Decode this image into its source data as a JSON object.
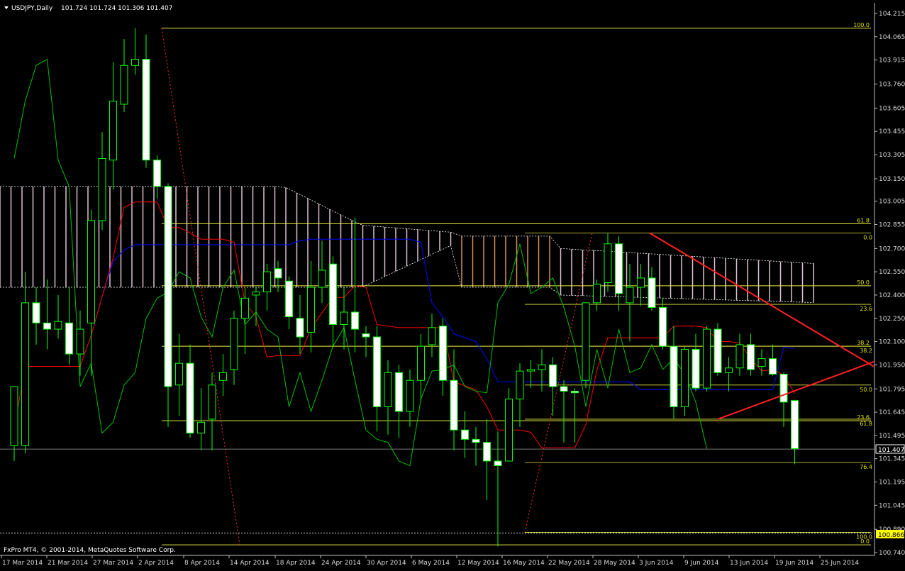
{
  "header": {
    "symbol": "USDJPY,Daily",
    "ohlc": "101.724 101.724 101.306 101.407"
  },
  "footer": "FxPro MT4, © 2001-2014, MetaQuotes Software Corp.",
  "current_price_label": "101.407",
  "marker_price_label": "100.866",
  "colors": {
    "background": "#000000",
    "bull_body": "#000000",
    "bear_body": "#ffffff",
    "candle_outline": "#00ff00",
    "tenkan": "#ff0000",
    "kijun": "#0000ff",
    "chikou": "#00c000",
    "cloud_up": "#f4d6ea",
    "cloud_down": "#f0a060",
    "fib": "#e8e840",
    "trendline": "#ff2020"
  },
  "chart_data": {
    "type": "candlestick",
    "instrument": "USDJPY",
    "timeframe": "Daily",
    "y_ticks": [
      "104.215",
      "104.065",
      "103.915",
      "103.760",
      "103.605",
      "103.455",
      "103.305",
      "103.150",
      "103.005",
      "102.855",
      "102.700",
      "102.550",
      "102.400",
      "102.250",
      "102.100",
      "101.950",
      "101.795",
      "101.645",
      "101.495",
      "101.345",
      "101.195",
      "101.045",
      "100.890",
      "100.740"
    ],
    "x_ticks": [
      "17 Mar 2014",
      "21 Mar 2014",
      "27 Mar 2014",
      "2 Apr 2014",
      "8 Apr 2014",
      "14 Apr 2014",
      "18 Apr 2014",
      "24 Apr 2014",
      "30 Apr 2014",
      "6 May 2014",
      "12 May 2014",
      "16 May 2014",
      "22 May 2014",
      "28 May 2014",
      "3 Jun 2014",
      "9 Jun 2014",
      "13 Jun 2014",
      "19 Jun 2014",
      "25 Jun 2014"
    ],
    "ylim": [
      100.74,
      104.215
    ],
    "candles": [
      {
        "o": 101.43,
        "h": 101.75,
        "l": 101.33,
        "c": 101.81
      },
      {
        "o": 101.43,
        "h": 102.55,
        "l": 101.38,
        "c": 102.35
      },
      {
        "o": 102.35,
        "h": 102.45,
        "l": 102.08,
        "c": 102.22
      },
      {
        "o": 102.22,
        "h": 102.5,
        "l": 102.05,
        "c": 102.18
      },
      {
        "o": 102.18,
        "h": 102.4,
        "l": 102.12,
        "c": 102.23
      },
      {
        "o": 102.22,
        "h": 102.45,
        "l": 101.95,
        "c": 102.02
      },
      {
        "o": 102.02,
        "h": 102.3,
        "l": 101.88,
        "c": 102.18
      },
      {
        "o": 102.22,
        "h": 102.95,
        "l": 101.88,
        "c": 102.88
      },
      {
        "o": 102.88,
        "h": 103.45,
        "l": 102.82,
        "c": 103.28
      },
      {
        "o": 103.27,
        "h": 103.9,
        "l": 103.08,
        "c": 103.65
      },
      {
        "o": 103.63,
        "h": 104.05,
        "l": 103.58,
        "c": 103.88
      },
      {
        "o": 103.88,
        "h": 104.12,
        "l": 103.82,
        "c": 103.92
      },
      {
        "o": 103.92,
        "h": 104.08,
        "l": 103.22,
        "c": 103.27
      },
      {
        "o": 103.27,
        "h": 103.3,
        "l": 103.02,
        "c": 103.1
      },
      {
        "o": 103.1,
        "h": 103.12,
        "l": 101.55,
        "c": 101.81
      },
      {
        "o": 101.82,
        "h": 102.15,
        "l": 101.62,
        "c": 101.96
      },
      {
        "o": 101.96,
        "h": 102.08,
        "l": 101.48,
        "c": 101.51
      },
      {
        "o": 101.51,
        "h": 101.8,
        "l": 101.4,
        "c": 101.58
      },
      {
        "o": 101.6,
        "h": 101.9,
        "l": 101.4,
        "c": 101.82
      },
      {
        "o": 101.85,
        "h": 102.02,
        "l": 101.75,
        "c": 101.9
      },
      {
        "o": 101.92,
        "h": 102.3,
        "l": 101.82,
        "c": 102.25
      },
      {
        "o": 102.25,
        "h": 102.45,
        "l": 102.02,
        "c": 102.38
      },
      {
        "o": 102.4,
        "h": 102.45,
        "l": 102.2,
        "c": 102.42
      },
      {
        "o": 102.42,
        "h": 102.6,
        "l": 102.3,
        "c": 102.55
      },
      {
        "o": 102.57,
        "h": 102.62,
        "l": 102.42,
        "c": 102.51
      },
      {
        "o": 102.49,
        "h": 102.52,
        "l": 102.18,
        "c": 102.26
      },
      {
        "o": 102.25,
        "h": 102.4,
        "l": 102.02,
        "c": 102.13
      },
      {
        "o": 102.16,
        "h": 102.62,
        "l": 102.03,
        "c": 102.45
      },
      {
        "o": 102.45,
        "h": 102.75,
        "l": 102.35,
        "c": 102.56
      },
      {
        "o": 102.6,
        "h": 102.65,
        "l": 102.06,
        "c": 102.21
      },
      {
        "o": 102.21,
        "h": 102.45,
        "l": 102.05,
        "c": 102.29
      },
      {
        "o": 102.29,
        "h": 102.9,
        "l": 102.03,
        "c": 102.18
      },
      {
        "o": 102.15,
        "h": 102.2,
        "l": 102.0,
        "c": 102.13
      },
      {
        "o": 102.13,
        "h": 102.2,
        "l": 101.52,
        "c": 101.68
      },
      {
        "o": 101.68,
        "h": 101.98,
        "l": 101.5,
        "c": 101.9
      },
      {
        "o": 101.9,
        "h": 101.95,
        "l": 101.48,
        "c": 101.65
      },
      {
        "o": 101.65,
        "h": 101.92,
        "l": 101.55,
        "c": 101.85
      },
      {
        "o": 101.85,
        "h": 102.15,
        "l": 101.72,
        "c": 102.07
      },
      {
        "o": 102.08,
        "h": 102.28,
        "l": 102.0,
        "c": 102.19
      },
      {
        "o": 102.2,
        "h": 102.25,
        "l": 101.75,
        "c": 101.85
      },
      {
        "o": 101.85,
        "h": 102.05,
        "l": 101.4,
        "c": 101.53
      },
      {
        "o": 101.53,
        "h": 101.65,
        "l": 101.35,
        "c": 101.47
      },
      {
        "o": 101.47,
        "h": 101.55,
        "l": 101.3,
        "c": 101.45
      },
      {
        "o": 101.45,
        "h": 101.6,
        "l": 101.08,
        "c": 101.33
      },
      {
        "o": 101.33,
        "h": 101.52,
        "l": 100.78,
        "c": 101.3
      },
      {
        "o": 101.33,
        "h": 101.8,
        "l": 101.33,
        "c": 101.73
      },
      {
        "o": 101.73,
        "h": 101.96,
        "l": 101.55,
        "c": 101.91
      },
      {
        "o": 101.91,
        "h": 101.98,
        "l": 101.8,
        "c": 101.92
      },
      {
        "o": 101.92,
        "h": 102.05,
        "l": 101.78,
        "c": 101.95
      },
      {
        "o": 101.95,
        "h": 102.0,
        "l": 101.62,
        "c": 101.81
      },
      {
        "o": 101.81,
        "h": 101.85,
        "l": 101.45,
        "c": 101.78
      },
      {
        "o": 101.78,
        "h": 101.8,
        "l": 101.45,
        "c": 101.77
      },
      {
        "o": 101.85,
        "h": 102.35,
        "l": 101.8,
        "c": 102.35
      },
      {
        "o": 102.35,
        "h": 102.5,
        "l": 102.3,
        "c": 102.47
      },
      {
        "o": 102.48,
        "h": 102.8,
        "l": 102.42,
        "c": 102.73
      },
      {
        "o": 102.73,
        "h": 102.78,
        "l": 102.3,
        "c": 102.41
      },
      {
        "o": 102.35,
        "h": 102.6,
        "l": 102.1,
        "c": 102.45
      },
      {
        "o": 102.45,
        "h": 102.6,
        "l": 102.33,
        "c": 102.51
      },
      {
        "o": 102.51,
        "h": 102.58,
        "l": 102.3,
        "c": 102.32
      },
      {
        "o": 102.32,
        "h": 102.38,
        "l": 102.05,
        "c": 102.07
      },
      {
        "o": 102.07,
        "h": 102.2,
        "l": 101.6,
        "c": 101.68
      },
      {
        "o": 101.68,
        "h": 102.07,
        "l": 101.62,
        "c": 102.05
      },
      {
        "o": 102.05,
        "h": 102.15,
        "l": 101.78,
        "c": 101.8
      },
      {
        "o": 101.8,
        "h": 102.2,
        "l": 101.78,
        "c": 102.18
      },
      {
        "o": 102.18,
        "h": 102.22,
        "l": 101.88,
        "c": 101.9
      },
      {
        "o": 101.9,
        "h": 102.0,
        "l": 101.78,
        "c": 101.93
      },
      {
        "o": 101.93,
        "h": 102.15,
        "l": 101.88,
        "c": 102.08
      },
      {
        "o": 102.08,
        "h": 102.15,
        "l": 101.88,
        "c": 101.92
      },
      {
        "o": 101.94,
        "h": 102.05,
        "l": 101.88,
        "c": 101.99
      },
      {
        "o": 101.99,
        "h": 102.08,
        "l": 101.88,
        "c": 101.89
      },
      {
        "o": 101.89,
        "h": 101.9,
        "l": 101.55,
        "c": 101.71
      },
      {
        "o": 101.72,
        "h": 101.72,
        "l": 101.31,
        "c": 101.41
      }
    ],
    "fibonacci_left": {
      "levels": [
        "100.0",
        "61.8",
        "50.0",
        "38.2",
        "23.6",
        "0.0"
      ],
      "prices": [
        104.12,
        102.86,
        102.46,
        102.07,
        101.59,
        100.79
      ]
    },
    "fibonacci_right": {
      "levels": [
        "0.0",
        "23.6",
        "38.2",
        "50.0",
        "61.8",
        "76.4",
        "100.0"
      ],
      "prices": [
        102.8,
        102.34,
        102.07,
        101.82,
        101.6,
        101.32,
        100.87
      ]
    },
    "grid": false,
    "legend": "none"
  }
}
